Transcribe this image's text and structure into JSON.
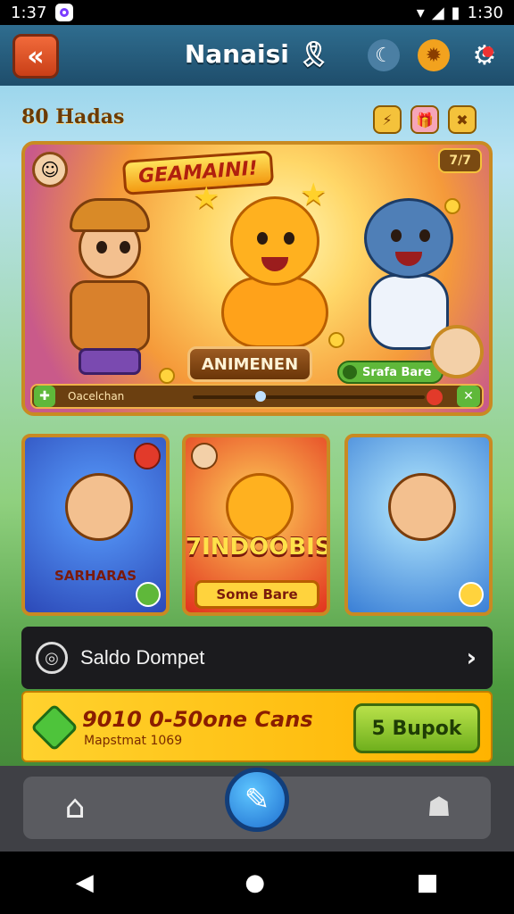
{
  "status_bar": {
    "time": "1:37",
    "time_right": "1:30",
    "icons": [
      "app-icon",
      "wifi-icon",
      "signal-icon",
      "battery-icon"
    ]
  },
  "header": {
    "title": "Nanaisi 🎗",
    "back_icon": "back-arrow-icon",
    "icons": [
      "moon-icon",
      "coin-chest-icon",
      "settings-icon"
    ]
  },
  "currency": {
    "label": "80 Hadas"
  },
  "top_badges": [
    "⚡",
    "🎁",
    "✖"
  ],
  "hero": {
    "title": "GEAMAINI!",
    "badge_text": "7/7",
    "cta": "ANIMENEN",
    "pill": "Srafa Bare",
    "bar_label": "Oacelchan"
  },
  "cards": [
    {
      "label": "SARHARAS"
    },
    {
      "title": "7INDOOBIS",
      "button": "Some Bare"
    },
    {
      "label": ""
    }
  ],
  "wallet": {
    "label": "Saldo Dompet",
    "chevron": "›"
  },
  "promo": {
    "title": "9010 0-50one Cans",
    "subtitle": "Mapstmat 1069",
    "button": "5 Bupok"
  },
  "nav": {
    "home_icon": "home-icon",
    "center_icon": "feather-icon",
    "people_icon": "people-icon"
  },
  "android_nav": {
    "back": "◀",
    "home": "●",
    "recent": "■"
  },
  "colors": {
    "header": "#1e4d6b",
    "accent_gold": "#c98a22",
    "promo_yellow": "#ffd22e",
    "cta_green": "#6fb01d"
  }
}
